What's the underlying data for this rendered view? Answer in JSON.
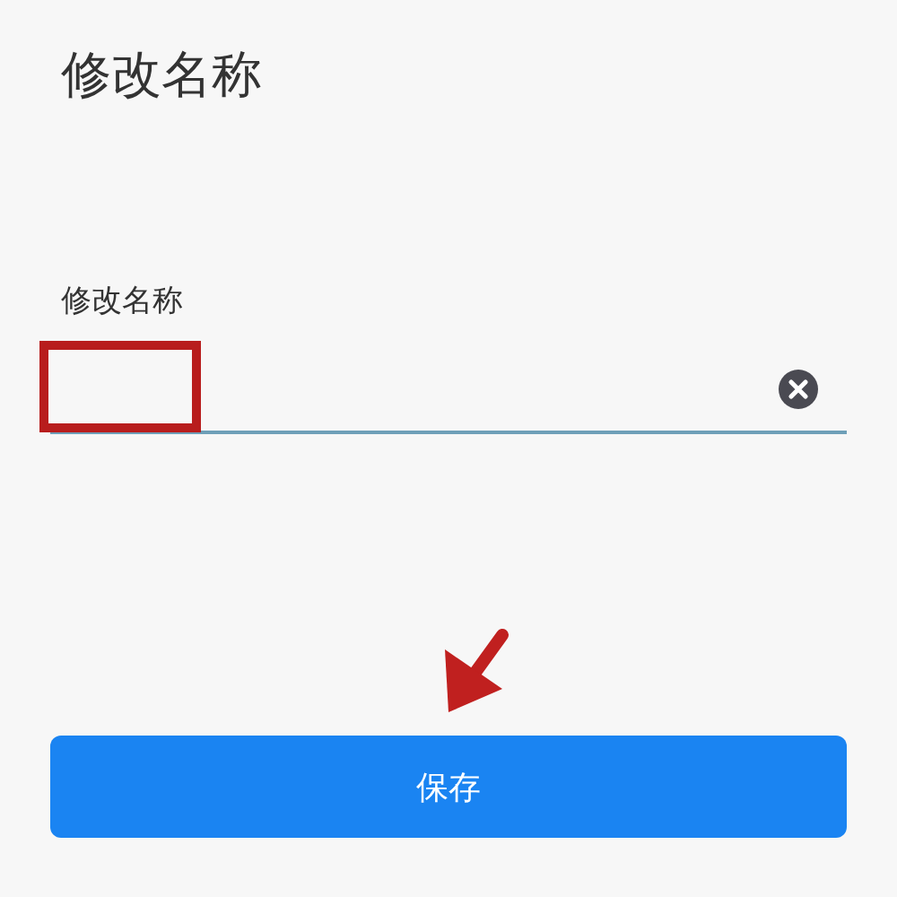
{
  "page": {
    "title": "修改名称"
  },
  "form": {
    "label": "修改名称",
    "button": "保存"
  }
}
